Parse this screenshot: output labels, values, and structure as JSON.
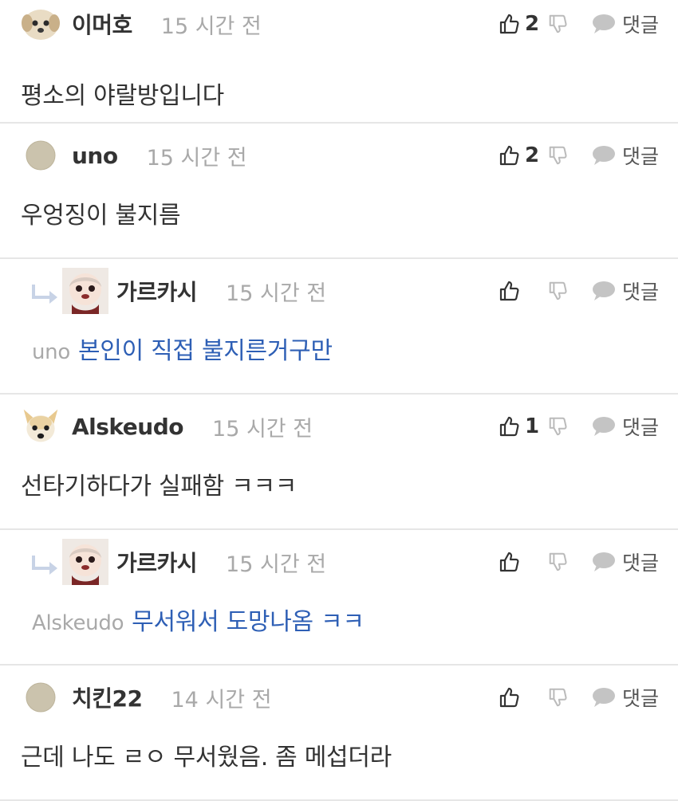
{
  "comments": [
    {
      "level": 0,
      "avatar": "dog-face-avatar",
      "author": "이머호",
      "time": "15 시간 전",
      "likes": "2",
      "reply_label": "댓글",
      "body": "평소의 야랄방입니다",
      "mention": "",
      "reply_text": ""
    },
    {
      "level": 0,
      "avatar": "default-circle-avatar",
      "author": "uno",
      "time": "15 시간 전",
      "likes": "2",
      "reply_label": "댓글",
      "body": "우엉징이 불지름",
      "mention": "",
      "reply_text": ""
    },
    {
      "level": 1,
      "avatar": "doll-avatar",
      "author": "가르카시",
      "time": "15 시간 전",
      "likes": "",
      "reply_label": "댓글",
      "body": "",
      "mention": "uno",
      "reply_text": "본인이 직접 불지른거구만"
    },
    {
      "level": 0,
      "avatar": "chihuahua-avatar",
      "author": "Alskeudo",
      "time": "15 시간 전",
      "likes": "1",
      "reply_label": "댓글",
      "body": "선타기하다가 실패함 ㅋㅋㅋ",
      "mention": "",
      "reply_text": ""
    },
    {
      "level": 1,
      "avatar": "doll-avatar",
      "author": "가르카시",
      "time": "15 시간 전",
      "likes": "",
      "reply_label": "댓글",
      "body": "",
      "mention": "Alskeudo",
      "reply_text": "무서워서 도망나옴 ㅋㅋ"
    },
    {
      "level": 0,
      "avatar": "default-circle-avatar",
      "author": "치킨22",
      "time": "14 시간 전",
      "likes": "",
      "reply_label": "댓글",
      "body": "근데 나도 ㄹㅇ 무서웠음. 좀 메섭더라",
      "mention": "",
      "reply_text": ""
    }
  ],
  "colors": {
    "reply_text": "#2e5fb5",
    "muted": "#a9a9a9",
    "text": "#333333",
    "divider": "#e6e6e6"
  }
}
